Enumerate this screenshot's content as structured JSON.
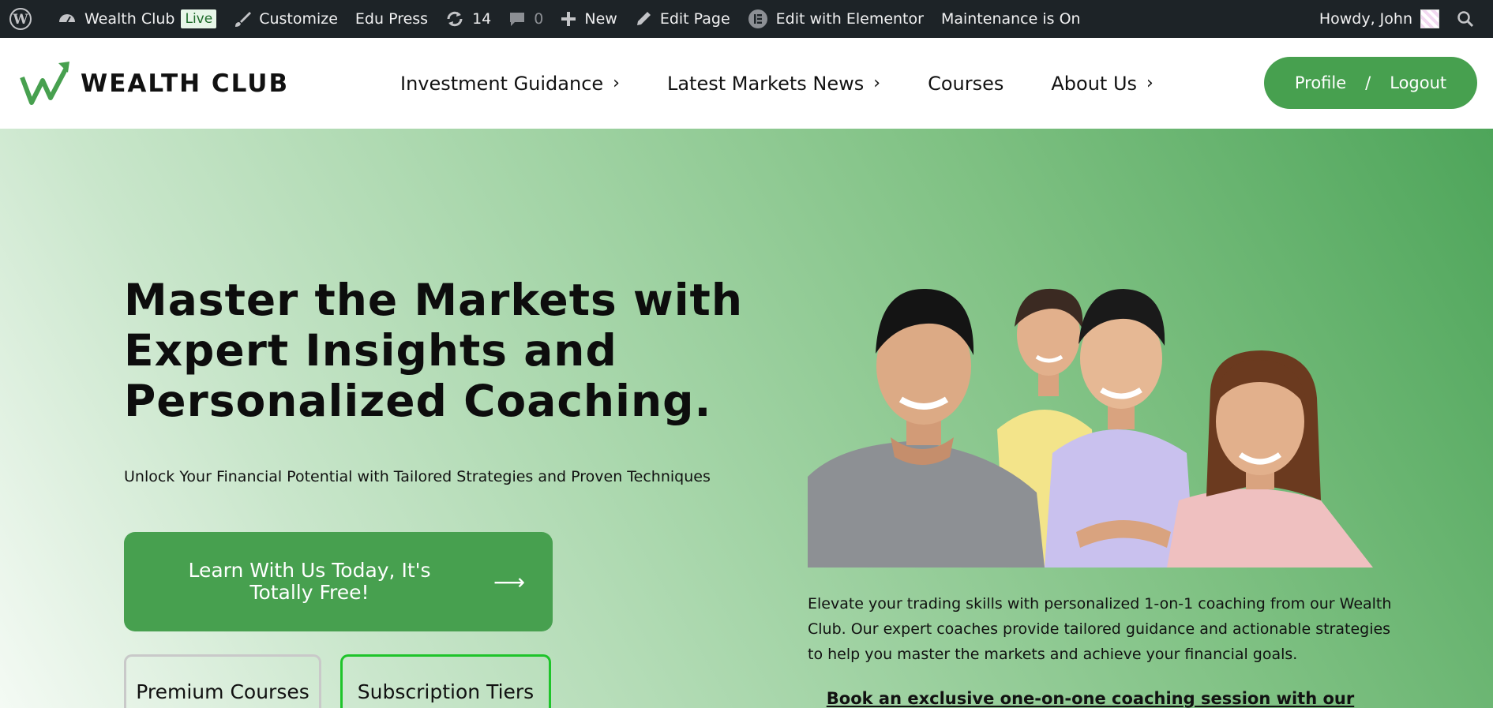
{
  "admin_bar": {
    "site_name": "Wealth Club",
    "live_badge": "Live",
    "customize": "Customize",
    "theme": "Edu Press",
    "updates_count": "14",
    "comments_count": "0",
    "new": "New",
    "edit_page": "Edit Page",
    "edit_elementor": "Edit with Elementor",
    "maintenance": "Maintenance is On",
    "greeting": "Howdy, John"
  },
  "header": {
    "logo_text": "WEALTH CLUB",
    "nav": [
      {
        "label": "Investment Guidance",
        "has_submenu": true
      },
      {
        "label": "Latest Markets News",
        "has_submenu": true
      },
      {
        "label": "Courses",
        "has_submenu": false
      },
      {
        "label": "About Us",
        "has_submenu": true
      }
    ],
    "profile": "Profile",
    "separator": "/",
    "logout": "Logout"
  },
  "hero": {
    "title": "Master the Markets with Expert Insights and Personalized Coaching.",
    "subtitle": "Unlock Your Financial Potential with Tailored Strategies and Proven Techniques",
    "cta_label": "Learn With Us Today, It's Totally Free!",
    "cta_arrow": "⟶",
    "premium_label": "Premium Courses",
    "subscription_label": "Subscription Tiers",
    "description": "Elevate your trading skills with personalized 1-on-1 coaching from our Wealth Club. Our expert coaches provide tailored guidance and actionable strategies to help you master the markets and achieve your financial goals.",
    "book_text": "Book an exclusive one-on-one coaching session with our experts!"
  },
  "colors": {
    "admin_bg": "#1d2327",
    "brand_green": "#47a04f",
    "tier_border_active": "#1ec42a"
  },
  "icons": [
    "wordpress-icon",
    "dashboard-icon",
    "brush-icon",
    "refresh-icon",
    "comment-icon",
    "plus-icon",
    "pencil-icon",
    "elementor-icon",
    "search-icon",
    "chevron-right-icon",
    "arrow-right-icon"
  ]
}
